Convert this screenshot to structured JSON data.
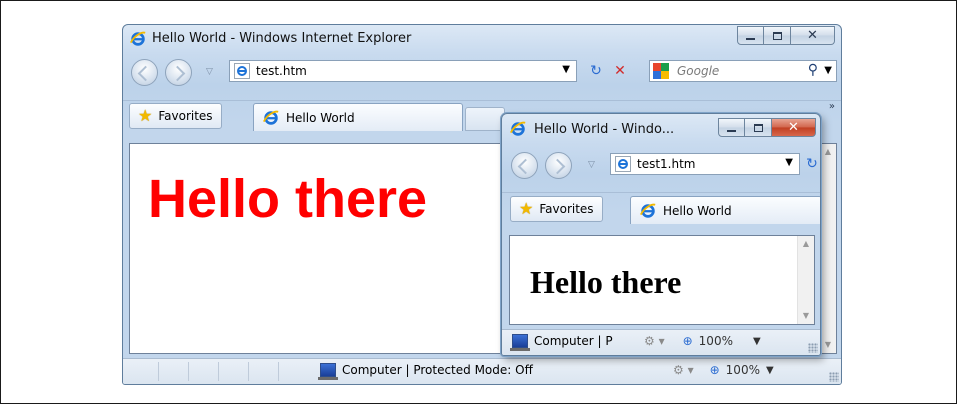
{
  "main_window": {
    "title": "Hello World - Windows Internet Explorer",
    "address": "test.htm",
    "search_placeholder": "Google",
    "favorites_label": "Favorites",
    "tab_label": "Hello World",
    "page_text": "Hello there",
    "page_text_color": "#ff0000",
    "status_zone": "Computer | Protected Mode: Off",
    "zoom": "100%"
  },
  "popup_window": {
    "title": "Hello World - Windo...",
    "address": "test1.htm",
    "favorites_label": "Favorites",
    "tab_label": "Hello World",
    "page_text": "Hello there",
    "status_zone": "Computer | P",
    "zoom": "100%"
  },
  "icons": {
    "back": "back-arrow-icon",
    "forward": "forward-arrow-icon",
    "refresh": "refresh-icon",
    "stop": "stop-icon",
    "search": "magnifier-icon",
    "favorites": "star-icon",
    "browser": "ie-logo-icon",
    "zone": "computer-zone-icon",
    "zoom": "zoom-icon"
  },
  "colors": {
    "chrome": "#c9dbef",
    "stop_red": "#d22b2b",
    "refresh_blue": "#2a6bd1"
  }
}
